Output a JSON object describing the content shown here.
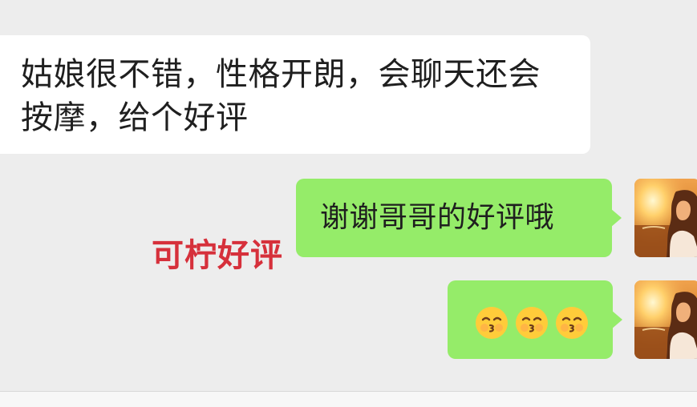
{
  "messages": [
    {
      "direction": "incoming",
      "text": "姑娘很不错，性格开朗，会聊天还会按摩，给个好评"
    },
    {
      "direction": "outgoing",
      "text": "谢谢哥哥的好评哦"
    },
    {
      "direction": "outgoing",
      "emoji": [
        "kissing-face-with-smiling-eyes",
        "kissing-face-with-smiling-eyes",
        "kissing-face-with-smiling-eyes"
      ]
    }
  ],
  "overlay": {
    "watermark_text": "可柠好评",
    "color": "#d6303b"
  },
  "colors": {
    "background": "#ededed",
    "incoming_bubble": "#ffffff",
    "outgoing_bubble": "#95ec69"
  },
  "icons": {
    "avatar": "sunset-portrait-avatar",
    "emoji": "kissing-face-with-smiling-eyes"
  }
}
